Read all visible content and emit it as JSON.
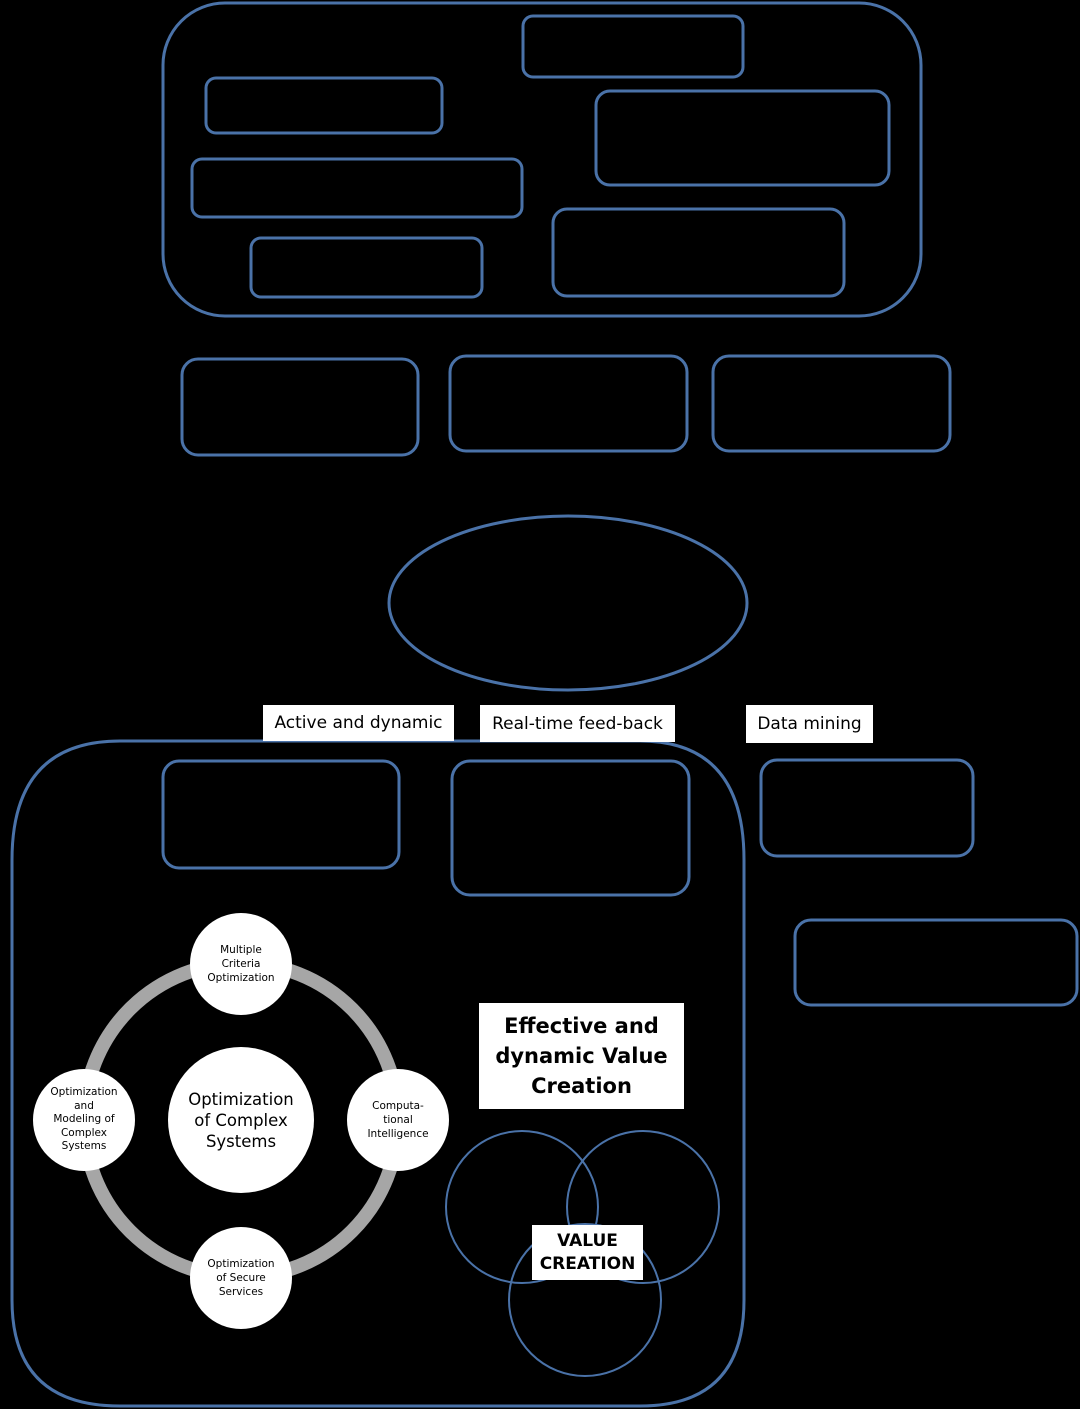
{
  "colors": {
    "background": "#000000",
    "box_stroke": "#4a72a8",
    "ring": "#a6a6a6",
    "label_fill": "#ffffff",
    "text": "#000000"
  },
  "top_group": {
    "container_label": "",
    "boxes": [
      "",
      "",
      "",
      "",
      "",
      "",
      ""
    ]
  },
  "middle_row": {
    "boxes": [
      "",
      "",
      ""
    ]
  },
  "center_ellipse": {
    "label": ""
  },
  "labels": {
    "active": "Active and dynamic",
    "realtime": "Real-time feed-back",
    "datamining": "Data mining"
  },
  "lower_row": {
    "boxes": [
      "",
      "",
      "",
      ""
    ]
  },
  "cycle": {
    "center": "Optimization\nof Complex\nSystems",
    "nodes": {
      "top": "Multiple\nCriteria\nOptimization",
      "right": "Computa-\ntional\nIntelligence",
      "bottom": "Optimization\nof Secure\nServices",
      "left": "Optimization\nand\nModeling of\nComplex\nSystems"
    }
  },
  "value_creation": {
    "heading": "Effective and dynamic Value Creation",
    "venn_label": "VALUE CREATION",
    "venn_circles": [
      "",
      "",
      ""
    ]
  }
}
